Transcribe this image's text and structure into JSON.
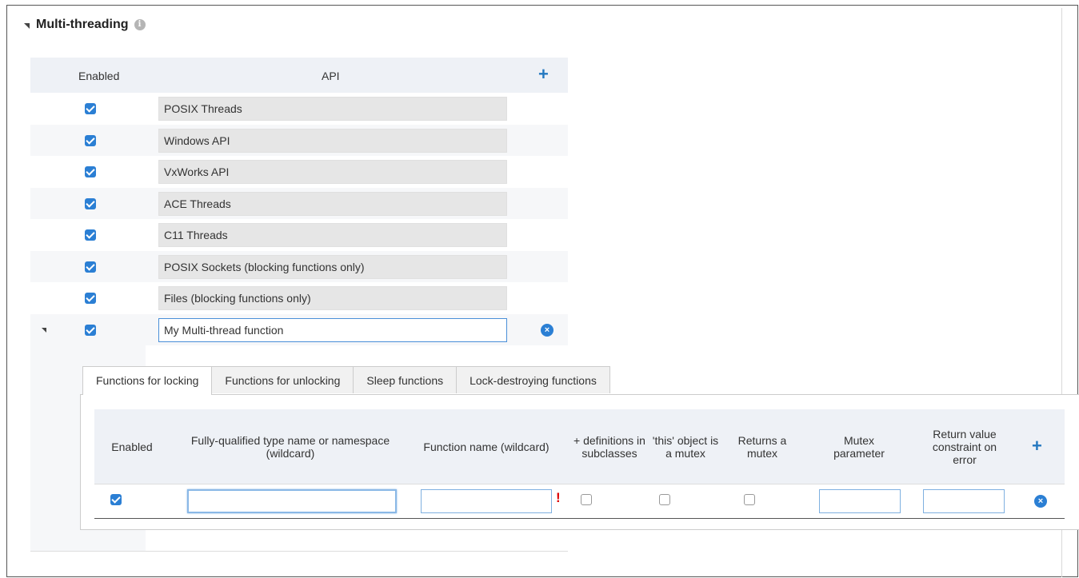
{
  "section": {
    "title": "Multi-threading",
    "info_icon": "i"
  },
  "api_table": {
    "header": {
      "enabled": "Enabled",
      "api": "API",
      "add": "+"
    },
    "rows": [
      {
        "enabled": true,
        "label": "POSIX Threads"
      },
      {
        "enabled": true,
        "label": "Windows API"
      },
      {
        "enabled": true,
        "label": "VxWorks API"
      },
      {
        "enabled": true,
        "label": "ACE Threads"
      },
      {
        "enabled": true,
        "label": "C11 Threads"
      },
      {
        "enabled": true,
        "label": "POSIX Sockets (blocking functions only)"
      },
      {
        "enabled": true,
        "label": "Files (blocking functions only)"
      },
      {
        "enabled": true,
        "label": "My Multi-thread function",
        "editable": true
      }
    ],
    "delete_icon": "×"
  },
  "tabs": [
    {
      "label": "Functions for locking",
      "active": true
    },
    {
      "label": "Functions for unlocking"
    },
    {
      "label": "Sleep functions"
    },
    {
      "label": "Lock-destroying functions"
    }
  ],
  "functions_table": {
    "headers": {
      "enabled": "Enabled",
      "type_name": "Fully-qualified type name or namespace (wildcard)",
      "function_name": "Function name (wildcard)",
      "definitions": "+ definitions in subclasses",
      "this_mutex": "'this' object is a mutex",
      "returns_mutex": "Returns a mutex",
      "mutex_param": "Mutex parameter",
      "return_constraint": "Return value constraint on error",
      "add": "+"
    },
    "row": {
      "enabled": true,
      "type_name": "",
      "function_name": "",
      "function_name_warning": "!",
      "definitions": false,
      "this_mutex": false,
      "returns_mutex": false,
      "mutex_param": "",
      "return_constraint": ""
    }
  },
  "colors": {
    "accent": "#2b7fd4",
    "header_bg": "#eef1f6",
    "warning": "#d00000"
  }
}
